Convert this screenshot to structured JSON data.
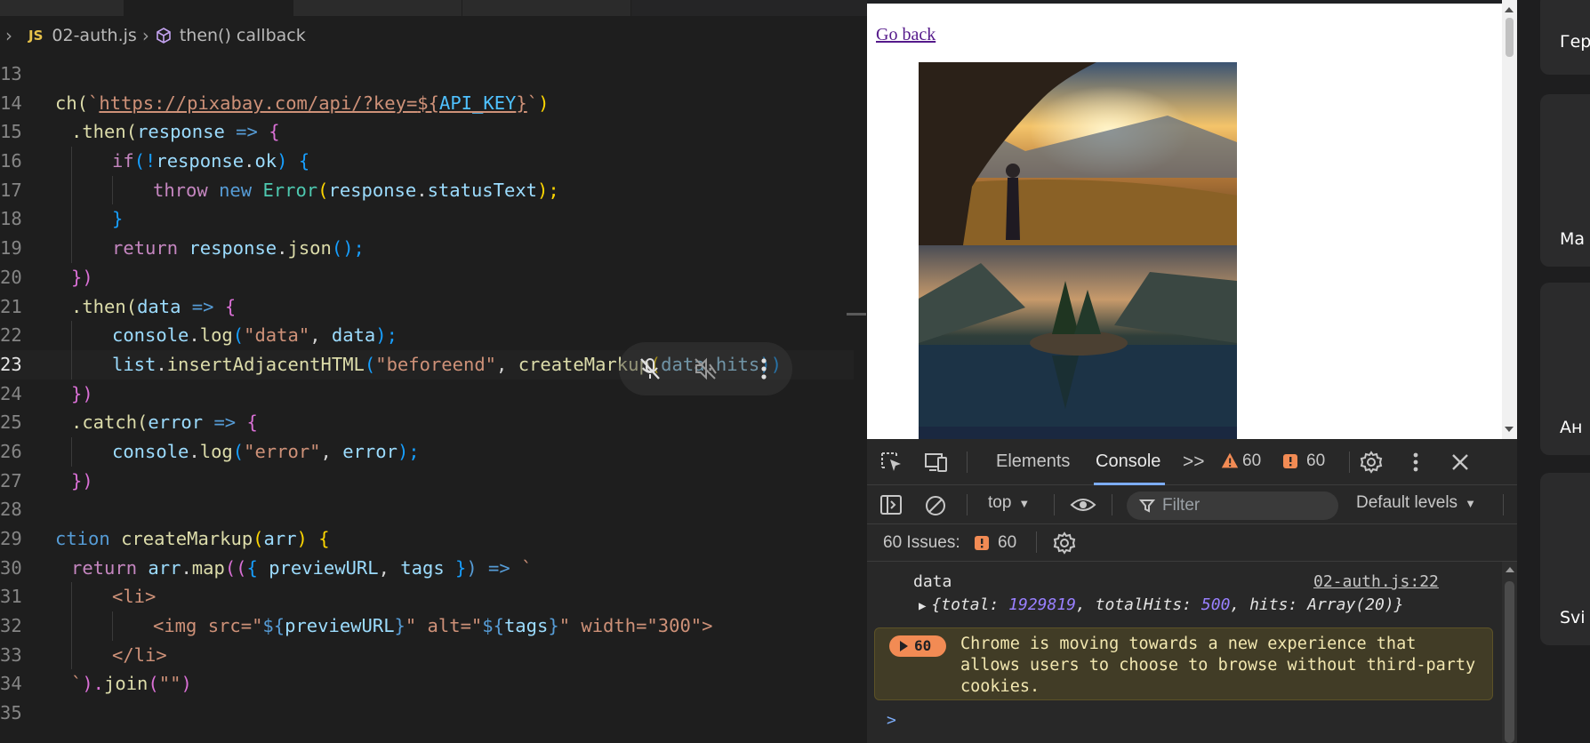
{
  "editor": {
    "breadcrumb": {
      "badge": "JS",
      "file": "02-auth.js",
      "symbol": "then() callback"
    },
    "code_lines": [
      {
        "n": "13"
      },
      {
        "n": "14"
      },
      {
        "n": "15"
      },
      {
        "n": "16"
      },
      {
        "n": "17"
      },
      {
        "n": "18"
      },
      {
        "n": "19"
      },
      {
        "n": "20"
      },
      {
        "n": "21"
      },
      {
        "n": "22"
      },
      {
        "n": "23"
      },
      {
        "n": "24"
      },
      {
        "n": "25"
      },
      {
        "n": "26"
      },
      {
        "n": "27"
      },
      {
        "n": "28"
      },
      {
        "n": "29"
      },
      {
        "n": "30"
      },
      {
        "n": "31"
      },
      {
        "n": "32"
      },
      {
        "n": "33"
      },
      {
        "n": "34"
      },
      {
        "n": "35"
      }
    ],
    "code": {
      "l14": {
        "a": "ch(",
        "b": "`",
        "url": "https://pixabay.com/api/?key=",
        "tpl_open": "${",
        "var": "API_KEY",
        "tpl_close": "}",
        "c": "`",
        "d": ")"
      },
      "l15": {
        "a": ".then(",
        "b": "response",
        "c": " => ",
        "d": "{"
      },
      "l16": {
        "a": "if",
        "b": "(!",
        "c": "response",
        "d": ".",
        "e": "ok",
        "f": ") ",
        "g": "{"
      },
      "l17": {
        "a": "throw ",
        "b": "new ",
        "c": "Error",
        "d": "(",
        "e": "response",
        "f": ".",
        "g": "statusText",
        "h": ");"
      },
      "l18": {
        "a": "}"
      },
      "l19": {
        "a": "return ",
        "b": "response",
        "c": ".",
        "d": "json",
        "e": "();"
      },
      "l20": {
        "a": "})"
      },
      "l21": {
        "a": ".then(",
        "b": "data",
        "c": " => ",
        "d": "{"
      },
      "l22": {
        "a": "console",
        "b": ".",
        "c": "log",
        "d": "(",
        "e": "\"data\"",
        "f": ", ",
        "g": "data",
        "h": ");"
      },
      "l23": {
        "a": "list",
        "b": ".",
        "c": "insertAdjacentHTML",
        "d": "(",
        "e": "\"beforeend\"",
        "f": ", ",
        "g": "createMarkup",
        "h": "(",
        "i": "data",
        "j": ".",
        "k": "hits",
        "l": "))"
      },
      "l24": {
        "a": "})"
      },
      "l25": {
        "a": ".catch(",
        "b": "error",
        "c": " => ",
        "d": "{"
      },
      "l26": {
        "a": "console",
        "b": ".",
        "c": "log",
        "d": "(",
        "e": "\"error\"",
        "f": ", ",
        "g": "error",
        "h": ");"
      },
      "l27": {
        "a": "})"
      },
      "l29": {
        "a": "ction ",
        "b": "createMarkup",
        "c": "(",
        "d": "arr",
        "e": ") ",
        "f": "{"
      },
      "l30": {
        "a": "return ",
        "b": "arr",
        "c": ".",
        "d": "map",
        "e": "((",
        "f": "{ ",
        "g": "previewURL",
        "h": ", ",
        "i": "tags",
        "j": " }",
        "k": ") => ",
        "l": "`"
      },
      "l31": {
        "a": "<li>"
      },
      "l32": {
        "a": "<img src=\"",
        "b": "${",
        "c": "previewURL",
        "d": "}",
        "e": "\" alt=\"",
        "f": "${",
        "g": "tags",
        "h": "}",
        "i": "\" width=\"300\">"
      },
      "l33": {
        "a": "</li>"
      },
      "l34": {
        "a": "`",
        "b": ").",
        "c": "join",
        "d": "(",
        "e": "\"\"",
        "f": ")"
      }
    }
  },
  "browser": {
    "link": "Go back"
  },
  "devtools": {
    "tabs": {
      "elements": "Elements",
      "console": "Console",
      "more": ">>"
    },
    "warning_count": "60",
    "error_count": "60",
    "context": "top",
    "filter_placeholder": "Filter",
    "levels": "Default levels",
    "issues_label": "60 Issues:",
    "issues_count": "60",
    "log": {
      "label": "data",
      "source": "02-auth.js:22",
      "obj_open": "{",
      "k_total": "total: ",
      "v_total": "1929819",
      "k_totalHits": ", totalHits: ",
      "v_totalHits": "500",
      "k_hits": ", hits: ",
      "v_hits": "Array(20)",
      "obj_close": "}"
    },
    "warning": {
      "badge": "60",
      "text": "Chrome is moving towards a new experience that allows users to choose to browse without third-party cookies."
    },
    "prompt": ">"
  },
  "participants": [
    {
      "name": "Гер"
    },
    {
      "name": "Ma"
    },
    {
      "name": "Ан"
    },
    {
      "name": "Svi"
    }
  ],
  "colors": {
    "editor_bg": "#1e1e1e",
    "devtools_bg": "#282828",
    "warning_bg": "#413c26",
    "warning_badge": "#f28b54",
    "accent": "#7cacf8"
  }
}
